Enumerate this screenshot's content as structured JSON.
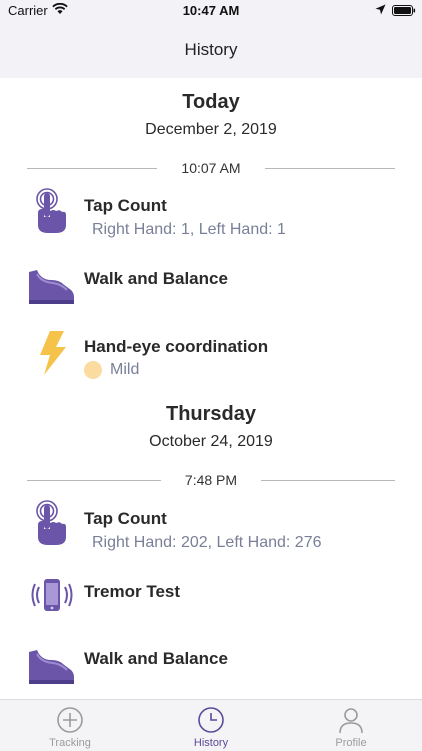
{
  "status_bar": {
    "carrier": "Carrier",
    "time": "10:47 AM"
  },
  "nav": {
    "title": "History"
  },
  "sections": [
    {
      "day": "Today",
      "date": "December 2, 2019",
      "time": "10:07 AM",
      "items": [
        {
          "title": "Tap Count",
          "subtitle": "Right Hand: 1, Left Hand: 1",
          "icon": "tap-hand-icon"
        },
        {
          "title": "Walk and Balance",
          "icon": "shoe-icon"
        },
        {
          "title": "Hand-eye coordination",
          "severity": "Mild",
          "icon": "lightning-icon"
        }
      ]
    },
    {
      "day": "Thursday",
      "date": "October 24, 2019",
      "time": "7:48 PM",
      "items": [
        {
          "title": "Tap Count",
          "subtitle": "Right Hand: 202, Left Hand: 276",
          "icon": "tap-hand-icon"
        },
        {
          "title": "Tremor Test",
          "icon": "vibrating-phone-icon"
        },
        {
          "title": "Walk and Balance",
          "icon": "shoe-icon"
        }
      ]
    }
  ],
  "tabs": [
    {
      "label": "Tracking",
      "icon": "plus-circle-icon",
      "active": false
    },
    {
      "label": "History",
      "icon": "clock-icon",
      "active": true
    },
    {
      "label": "Profile",
      "icon": "person-icon",
      "active": false
    }
  ],
  "colors": {
    "accent": "#5c4a98",
    "icon_purple": "#6b55a8",
    "lightning": "#f5c24a",
    "mild": "#fbdba0"
  }
}
